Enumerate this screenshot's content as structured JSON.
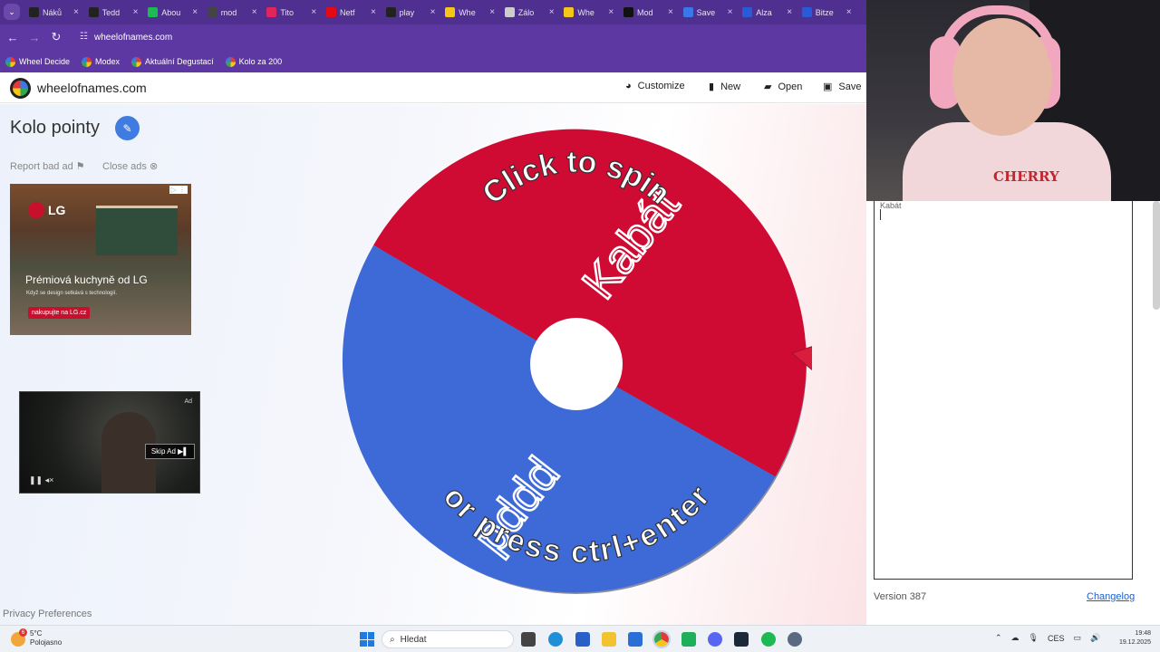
{
  "browser": {
    "tabs": [
      {
        "label": "Náků",
        "color": "#222222"
      },
      {
        "label": "Tedd",
        "color": "#222222"
      },
      {
        "label": "Abou",
        "color": "#1db954"
      },
      {
        "label": "mod",
        "color": "#444444"
      },
      {
        "label": "Tito",
        "color": "#e0245e"
      },
      {
        "label": "Netf",
        "color": "#e50914"
      },
      {
        "label": "play",
        "color": "#222222"
      },
      {
        "label": "Whe",
        "color": "#f5c518"
      },
      {
        "label": "Zálo",
        "color": "#cccccc"
      },
      {
        "label": "Whe",
        "color": "#f5c518"
      },
      {
        "label": "Mod",
        "color": "#111111"
      },
      {
        "label": "Save",
        "color": "#3a78e8"
      },
      {
        "label": "Alza",
        "color": "#2a5bd7"
      },
      {
        "label": "Bitze",
        "color": "#2a5bd7"
      }
    ],
    "url": "wheelofnames.com",
    "bookmarks": [
      "Wheel Decide",
      "Modex",
      "Aktuální Degustací",
      "Kolo za 200"
    ]
  },
  "site": {
    "name": "wheelofnames.com",
    "menu": [
      {
        "label": "Customize",
        "icon": "palette-icon"
      },
      {
        "label": "New",
        "icon": "file-icon"
      },
      {
        "label": "Open",
        "icon": "folder-open-icon"
      },
      {
        "label": "Save",
        "icon": "save-icon"
      }
    ]
  },
  "page": {
    "title": "Kolo pointy",
    "report_ad": "Report bad ad",
    "close_ads": "Close ads",
    "privacy": "Privacy Preferences"
  },
  "ad_lg": {
    "brand": "LG",
    "headline": "Prémiová kuchyně od LG",
    "sub": "Když se design setkává s technologií.",
    "cta": "nakupujte na LG.cz"
  },
  "ad_video": {
    "label": "Ad",
    "skip": "Skip Ad ▶▌"
  },
  "wheel": {
    "segments": [
      {
        "label": "Kabát",
        "color": "#cf0a33"
      },
      {
        "label": "pppd",
        "color": "#3d6ad6"
      }
    ],
    "prompt_top": "Click to spin",
    "prompt_bottom": "or press ctrl+enter",
    "pointer_color": "#d81e3c"
  },
  "sidebar": {
    "entries_text": "Kabát",
    "version": "Version 387",
    "changelog": "Changelog"
  },
  "webcam": {
    "shirt_text": "CHERRY"
  },
  "taskbar": {
    "weather_temp": "5°C",
    "weather_desc": "Polojasno",
    "weather_badge": "6",
    "search_placeholder": "Hledat",
    "lang": "CES",
    "time": "19:48",
    "date": "19.12.2025"
  }
}
